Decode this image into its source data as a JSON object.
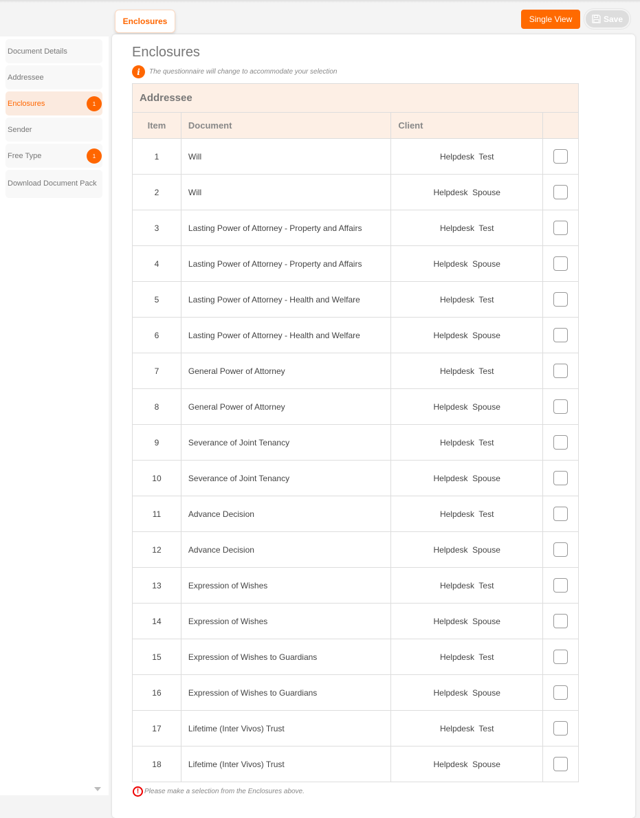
{
  "top_tab": "Enclosures",
  "toolbar": {
    "single_view": "Single View",
    "save": "Save"
  },
  "sidebar": {
    "items": [
      {
        "label": "Document Details"
      },
      {
        "label": "Addressee"
      },
      {
        "label": "Enclosures",
        "badge": "1",
        "active": true
      },
      {
        "label": "Sender"
      },
      {
        "label": "Free Type",
        "badge": "1"
      },
      {
        "label": "Download Document Pack"
      }
    ]
  },
  "page_title": "Enclosures",
  "info_text": "The questionnaire will change to accommodate your selection",
  "table": {
    "title": "Addressee",
    "headers": [
      "Item",
      "Document",
      "Client",
      ""
    ],
    "rows": [
      [
        "1",
        "Will",
        "Helpdesk  Test"
      ],
      [
        "2",
        "Will",
        "Helpdesk  Spouse"
      ],
      [
        "3",
        "Lasting Power of Attorney - Property and Affairs",
        "Helpdesk  Test"
      ],
      [
        "4",
        "Lasting Power of Attorney - Property and Affairs",
        "Helpdesk  Spouse"
      ],
      [
        "5",
        "Lasting Power of Attorney - Health and Welfare",
        "Helpdesk  Test"
      ],
      [
        "6",
        "Lasting Power of Attorney - Health and Welfare",
        "Helpdesk  Spouse"
      ],
      [
        "7",
        "General Power of Attorney",
        "Helpdesk  Test"
      ],
      [
        "8",
        "General Power of Attorney",
        "Helpdesk  Spouse"
      ],
      [
        "9",
        "Severance of Joint Tenancy",
        "Helpdesk  Test"
      ],
      [
        "10",
        "Severance of Joint Tenancy",
        "Helpdesk  Spouse"
      ],
      [
        "11",
        "Advance Decision",
        "Helpdesk  Test"
      ],
      [
        "12",
        "Advance Decision",
        "Helpdesk  Spouse"
      ],
      [
        "13",
        "Expression of Wishes",
        "Helpdesk  Test"
      ],
      [
        "14",
        "Expression of Wishes",
        "Helpdesk  Spouse"
      ],
      [
        "15",
        "Expression of Wishes to Guardians",
        "Helpdesk  Test"
      ],
      [
        "16",
        "Expression of Wishes to Guardians",
        "Helpdesk  Spouse"
      ],
      [
        "17",
        "Lifetime (Inter Vivos) Trust",
        "Helpdesk  Test"
      ],
      [
        "18",
        "Lifetime (Inter Vivos) Trust",
        "Helpdesk  Spouse"
      ]
    ]
  },
  "warning_text": "Please make a selection from the Enclosures above.",
  "colors": {
    "accent": "#ff6a00",
    "header_bg": "#fdefe5",
    "error": "#ee0000"
  }
}
